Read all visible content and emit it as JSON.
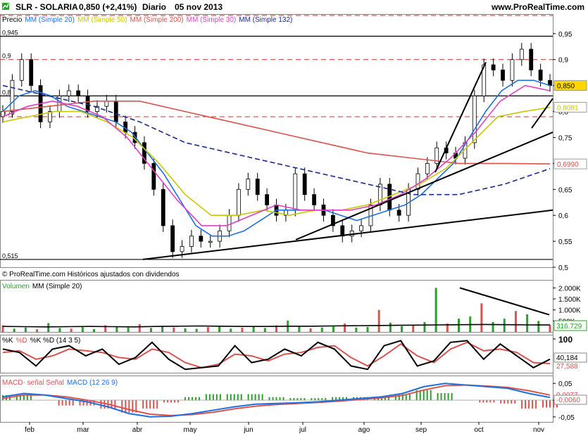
{
  "header": {
    "ticker": "SLR - SOLARIA",
    "quote": "0,850 (+2,41%)",
    "period": "Diario",
    "date": "05 nov 2013",
    "website": "www.ProRealTime.com"
  },
  "chart_data": [
    {
      "type": "candlestick",
      "title": "SLR - SOLARIA",
      "legend": [
        {
          "name": "Precio",
          "color": "#000000"
        },
        {
          "name": "MM (Simple 20)",
          "color": "#1e6fe0"
        },
        {
          "name": "MM (Simple 50)",
          "color": "#c8c800"
        },
        {
          "name": "MM (Simple 200)",
          "color": "#d9534f"
        },
        {
          "name": "MM (Simple 30)",
          "color": "#e040c0"
        },
        {
          "name": "MM (Simple 132)",
          "color": "#1a2a8a"
        }
      ],
      "legend_placement": "top-left",
      "x_months": [
        "feb",
        "mar",
        "abr",
        "may",
        "jun",
        "jul",
        "ago",
        "sep",
        "oct",
        "nov"
      ],
      "y_ticks": [
        "0,95",
        "0,9",
        "0,85",
        "0,8",
        "0,75",
        "0,7",
        "0,65",
        "0,6",
        "0,55",
        "0,5"
      ],
      "ylim": [
        0.5,
        0.985
      ],
      "price_boxes": [
        {
          "label": "0,850",
          "value": 0.85,
          "bg": "#ffd700"
        },
        {
          "label": "0,8081",
          "value": 0.8081,
          "bg": "#ffffff",
          "color": "#c8c800"
        },
        {
          "label": "0,6990",
          "value": 0.699,
          "bg": "#ffffff",
          "color": "#d9534f"
        }
      ],
      "left_labels": [
        "0,945",
        "0,9",
        "0,83",
        "0,79",
        "0,515"
      ],
      "horizontal_levels_solid": [
        0.945,
        0.83,
        0.515
      ],
      "horizontal_levels_dashed": [
        0.985,
        0.9,
        0.79
      ],
      "trendlines": [
        {
          "from": [
            "abr",
            0.515
          ],
          "to": [
            "nov",
            0.61
          ]
        },
        {
          "from": [
            "jul",
            0.553
          ],
          "to": [
            "nov",
            0.76
          ]
        },
        {
          "from": [
            "sep",
            0.683
          ],
          "to": [
            "sep",
            0.895
          ]
        },
        {
          "from": [
            "oct",
            0.768
          ],
          "to": [
            "nov",
            0.825
          ]
        }
      ],
      "series": [
        {
          "name": "Precio",
          "values": [
            0.8,
            0.86,
            0.9,
            0.85,
            0.78,
            0.8,
            0.83,
            0.84,
            0.83,
            0.8,
            0.81,
            0.82,
            0.78,
            0.76,
            0.74,
            0.7,
            0.65,
            0.58,
            0.53,
            0.54,
            0.56,
            0.55,
            0.55,
            0.57,
            0.6,
            0.65,
            0.67,
            0.64,
            0.62,
            0.6,
            0.61,
            0.68,
            0.64,
            0.62,
            0.6,
            0.58,
            0.56,
            0.57,
            0.58,
            0.62,
            0.66,
            0.61,
            0.6,
            0.65,
            0.68,
            0.7,
            0.73,
            0.72,
            0.71,
            0.74,
            0.83,
            0.89,
            0.88,
            0.86,
            0.9,
            0.92,
            0.88,
            0.86,
            0.85
          ]
        },
        {
          "name": "MM (Simple 20)",
          "values": [
            0.8,
            0.83,
            0.84,
            0.83,
            0.81,
            0.8,
            0.79,
            0.78,
            0.76,
            0.72,
            0.68,
            0.63,
            0.58,
            0.56,
            0.56,
            0.57,
            0.59,
            0.61,
            0.61,
            0.61,
            0.61,
            0.6,
            0.59,
            0.6,
            0.61,
            0.62,
            0.64,
            0.67,
            0.7,
            0.75,
            0.8,
            0.84,
            0.86,
            0.86,
            0.85
          ]
        },
        {
          "name": "MM (Simple 50)",
          "values": [
            0.78,
            0.79,
            0.8,
            0.8,
            0.78,
            0.75,
            0.7,
            0.64,
            0.6,
            0.6,
            0.61,
            0.6,
            0.61,
            0.61,
            0.62,
            0.64,
            0.66,
            0.69,
            0.74,
            0.79,
            0.8,
            0.808
          ]
        },
        {
          "name": "MM (Simple 200)",
          "values": [
            0.8,
            0.81,
            0.82,
            0.82,
            0.8,
            0.78,
            0.76,
            0.74,
            0.72,
            0.71,
            0.7,
            0.7,
            0.699
          ]
        },
        {
          "name": "MM (Simple 30)",
          "values": [
            0.79,
            0.81,
            0.82,
            0.81,
            0.79,
            0.75,
            0.69,
            0.63,
            0.58,
            0.58,
            0.6,
            0.62,
            0.61,
            0.61,
            0.61,
            0.62,
            0.64,
            0.67,
            0.71,
            0.76,
            0.82,
            0.85,
            0.84
          ]
        },
        {
          "name": "MM (Simple 132)",
          "values": [
            0.85,
            0.83,
            0.81,
            0.78,
            0.74,
            0.72,
            0.7,
            0.68,
            0.66,
            0.64,
            0.64,
            0.66,
            0.69
          ]
        }
      ]
    },
    {
      "type": "bar",
      "title": "Volumen",
      "legend": [
        {
          "name": "Volumen",
          "color": "#2ca02c"
        },
        {
          "name": "MM (Simple 20)",
          "color": "#000000"
        }
      ],
      "y_ticks": [
        "2.000K",
        "1.500K",
        "1.000K",
        "500K"
      ],
      "last_value": "316.729",
      "ylim": [
        0,
        2300
      ],
      "values": [
        300,
        150,
        200,
        120,
        400,
        180,
        150,
        220,
        130,
        300,
        260,
        200,
        350,
        180,
        240,
        200,
        160,
        140,
        220,
        260,
        150,
        190,
        240,
        180,
        300,
        520,
        260,
        160,
        200,
        250,
        380,
        200,
        230,
        1000,
        420,
        260,
        300,
        450,
        2000,
        380,
        600,
        700,
        1300,
        450,
        600,
        950,
        800,
        500,
        316
      ],
      "ma": [
        250,
        240,
        230,
        240,
        250,
        240,
        230,
        250,
        260,
        270,
        260,
        250,
        250,
        260,
        260,
        270,
        280,
        290,
        300,
        310,
        320,
        330,
        340,
        330,
        320,
        316
      ],
      "trendline": {
        "from": 2000,
        "to": 780
      }
    },
    {
      "type": "line",
      "title": "%K %D (14 3 5)",
      "legend": [
        {
          "name": "%K",
          "color": "#000000"
        },
        {
          "name": "%D",
          "color": "#d9534f"
        }
      ],
      "y_ticks": [
        "100"
      ],
      "last_values": [
        "40,184",
        "27,588"
      ],
      "ylim": [
        0,
        100
      ],
      "k": [
        70,
        60,
        20,
        70,
        80,
        50,
        70,
        25,
        45,
        90,
        40,
        10,
        15,
        20,
        80,
        30,
        40,
        70,
        50,
        90,
        70,
        20,
        10,
        80,
        95,
        20,
        35,
        90,
        95,
        40,
        85,
        50,
        15,
        40
      ],
      "d": [
        60,
        65,
        40,
        50,
        70,
        65,
        60,
        45,
        40,
        70,
        60,
        30,
        15,
        25,
        55,
        50,
        35,
        55,
        60,
        75,
        80,
        45,
        20,
        50,
        85,
        50,
        30,
        70,
        90,
        65,
        70,
        60,
        30,
        27
      ]
    },
    {
      "type": "line",
      "title": "MACD",
      "legend": [
        {
          "name": "MACD- señal Señal",
          "color": "#d9534f"
        },
        {
          "name": "MACD (12 26 9)",
          "color": "#1e6fe0"
        }
      ],
      "y_ticks": [
        "0,05",
        "0",
        "-0,05"
      ],
      "last_values": [
        "0,0077",
        "-0,0060"
      ],
      "ylim": [
        -0.065,
        0.065
      ],
      "macd": [
        0.01,
        0.02,
        0.015,
        0.005,
        -0.005,
        -0.02,
        -0.04,
        -0.05,
        -0.048,
        -0.04,
        -0.03,
        -0.02,
        -0.012,
        -0.01,
        -0.008,
        -0.005,
        0.0,
        0.005,
        0.01,
        0.02,
        0.04,
        0.05,
        0.045,
        0.04,
        0.035,
        0.02,
        0.008
      ],
      "signal": [
        0.005,
        0.015,
        0.015,
        0.01,
        0.0,
        -0.012,
        -0.028,
        -0.042,
        -0.046,
        -0.043,
        -0.036,
        -0.026,
        -0.018,
        -0.013,
        -0.01,
        -0.007,
        -0.003,
        0.002,
        0.007,
        0.014,
        0.03,
        0.043,
        0.045,
        0.042,
        0.038,
        0.028,
        0.015
      ]
    }
  ],
  "footer_notice": "© ProRealTime.com Históricos ajustados con dividendos"
}
